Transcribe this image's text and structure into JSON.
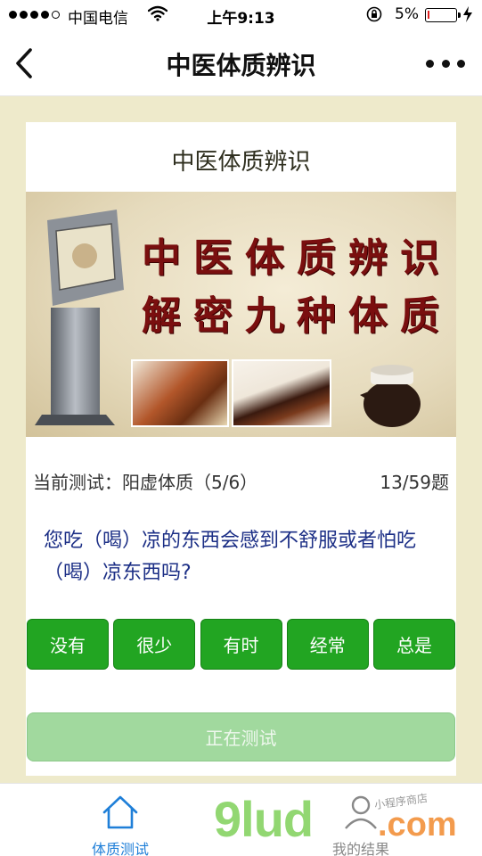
{
  "status_bar": {
    "carrier": "中国电信",
    "time": "上午9:13",
    "battery_percent": "5%",
    "battery_level": 0.05,
    "signal_icon": "signal-dots-icon",
    "wifi_icon": "wifi-icon",
    "lock_icon": "rotation-lock-icon",
    "charge_icon": "charging-bolt-icon"
  },
  "nav": {
    "title": "中医体质辨识",
    "back_icon": "chevron-left-icon",
    "more_icon": "more-dots-icon"
  },
  "card": {
    "title": "中医体质辨识",
    "banner": {
      "line1": "中医体质辨识",
      "line2": "解密九种体质"
    },
    "progress": {
      "current_test": "当前测试：阳虚体质（5/6）",
      "count": "13/59题"
    },
    "question": "您吃（喝）凉的东西会感到不舒服或者怕吃（喝）凉东西吗?",
    "options": [
      "没有",
      "很少",
      "有时",
      "经常",
      "总是"
    ],
    "status_button": "正在测试"
  },
  "tab_bar": {
    "items": [
      {
        "label": "体质测试",
        "icon": "home-icon",
        "active": true
      },
      {
        "label": "我的结果",
        "icon": "user-icon",
        "active": false
      }
    ]
  },
  "watermark": {
    "main": "9lud",
    "domain": ".com",
    "sub": "小程序商店"
  },
  "colors": {
    "accent_green": "#22a522",
    "disabled_green": "#a1d99e",
    "question_blue": "#1c2f86",
    "tab_active_blue": "#1f7fd8",
    "page_background": "#eeeacb"
  }
}
